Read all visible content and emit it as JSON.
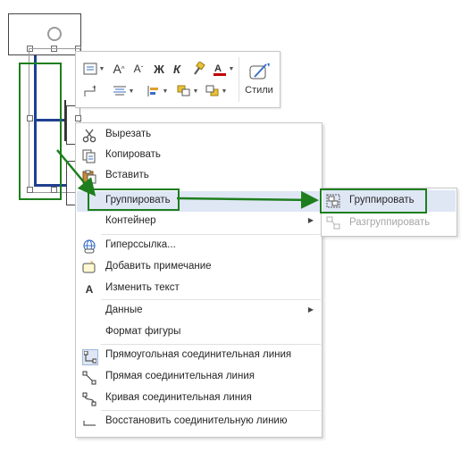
{
  "minibar": {
    "font_grow": "A",
    "font_shrink": "A",
    "bold": "Ж",
    "italic": "К",
    "styles_label": "Стили"
  },
  "context_menu": {
    "items": [
      {
        "label": "Вырезать",
        "icon": "scissors-icon"
      },
      {
        "label": "Копировать",
        "icon": "copy-icon"
      },
      {
        "label": "Вставить",
        "icon": "paste-icon"
      },
      {
        "label": "Группировать",
        "icon": "",
        "submenu": true,
        "highlighted": true
      },
      {
        "label": "Контейнер",
        "icon": "",
        "submenu": true
      },
      {
        "label": "Гиперссылка...",
        "icon": "hyperlink-icon"
      },
      {
        "label": "Добавить примечание",
        "icon": "comment-icon"
      },
      {
        "label": "Изменить текст",
        "icon": "edit-text-icon",
        "icon_glyph": "A"
      },
      {
        "label": "Данные",
        "icon": "",
        "submenu": true
      },
      {
        "label": "Формат фигуры",
        "icon": ""
      },
      {
        "label": "Прямоугольная соединительная линия",
        "icon": "right-angle-connector-icon"
      },
      {
        "label": "Прямая соединительная линия",
        "icon": "straight-connector-icon"
      },
      {
        "label": "Кривая соединительная линия",
        "icon": "curved-connector-icon"
      },
      {
        "label": "Восстановить соединительную линию",
        "icon": "reset-connector-icon"
      }
    ]
  },
  "submenu": {
    "items": [
      {
        "label": "Группировать",
        "icon": "group-icon",
        "highlighted": true
      },
      {
        "label": "Разгруппировать",
        "icon": "ungroup-icon",
        "disabled": true
      }
    ]
  },
  "colors": {
    "highlight": "#dfe7f5",
    "annotation_green": "#1e7e1e",
    "connector_blue": "#1f3f8f",
    "menu_border": "#c6c6c6"
  }
}
